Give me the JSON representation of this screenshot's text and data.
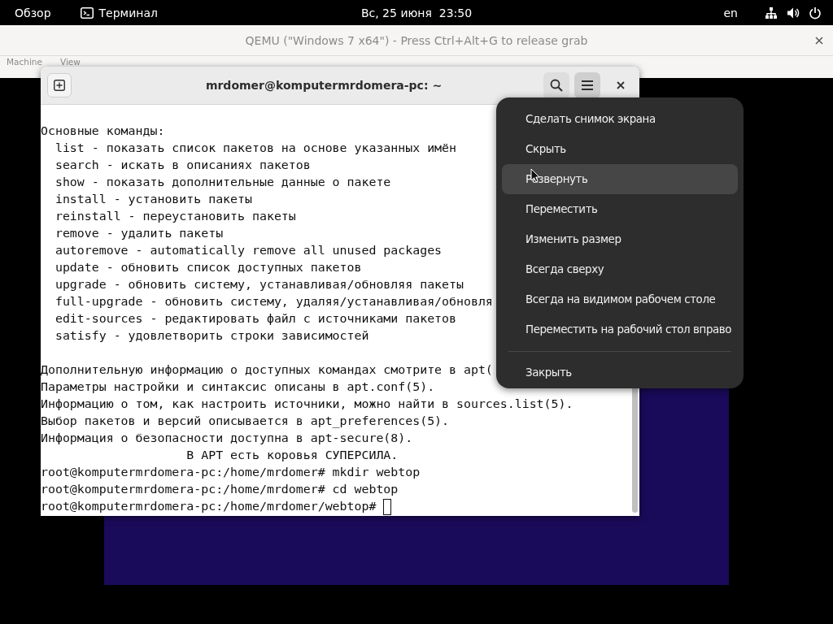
{
  "top_bar": {
    "activities": "Обзор",
    "app": "Терминал",
    "clock": "Вс, 25 июня  23:50",
    "keyboard_layout": "en"
  },
  "qemu_window": {
    "title": "QEMU (\"Windows 7 x64\") - Press Ctrl+Alt+G to release grab",
    "menu": [
      "Machine",
      "View"
    ]
  },
  "terminal": {
    "title": "mrdomer@komputermrdomera-pc: ~",
    "menu_open": true,
    "cursor_visible": true,
    "blocks": [
      [
        "Основные команды:",
        "  list - показать список пакетов на основе указанных имён",
        "  search - искать в описаниях пакетов",
        "  show - показать дополнительные данные о пакете",
        "  install - установить пакеты",
        "  reinstall - переустановить пакеты",
        "  remove - удалить пакеты",
        "  autoremove - automatically remove all unused packages",
        "  update - обновить список доступных пакетов",
        "  upgrade - обновить систему, устанавливая/обновляя пакеты",
        "  full-upgrade - обновить систему, удаляя/устанавливая/обновля",
        "  edit-sources - редактировать файл с источниками пакетов",
        "  satisfy - удовлетворить строки зависимостей"
      ],
      [
        "Дополнительную информацию о доступных командах смотрите в apt(",
        "Параметры настройки и синтаксис описаны в apt.conf(5).",
        "Информацию о том, как настроить источники, можно найти в sources.list(5).",
        "Выбор пакетов и версий описывается в apt_preferences(5).",
        "Информация о безопасности доступна в apt-secure(8).",
        "                    В APT есть коровья СУПЕРСИЛА.",
        "root@komputermrdomera-pc:/home/mrdomer# mkdir webtop",
        "root@komputermrdomera-pc:/home/mrdomer# cd webtop",
        "root@komputermrdomera-pc:/home/mrdomer/webtop# "
      ]
    ]
  },
  "window_menu": {
    "sections": [
      [
        {
          "label": "Сделать снимок экрана",
          "selected": false
        },
        {
          "label": "Скрыть",
          "selected": false
        },
        {
          "label": "Развернуть",
          "selected": true
        },
        {
          "label": "Переместить",
          "selected": false
        },
        {
          "label": "Изменить размер",
          "selected": false
        },
        {
          "label": "Всегда сверху",
          "selected": false
        },
        {
          "label": "Всегда на видимом рабочем столе",
          "selected": false
        },
        {
          "label": "Переместить на рабочий стол вправо",
          "selected": false
        }
      ],
      [
        {
          "label": "Закрыть",
          "selected": false
        }
      ]
    ]
  }
}
